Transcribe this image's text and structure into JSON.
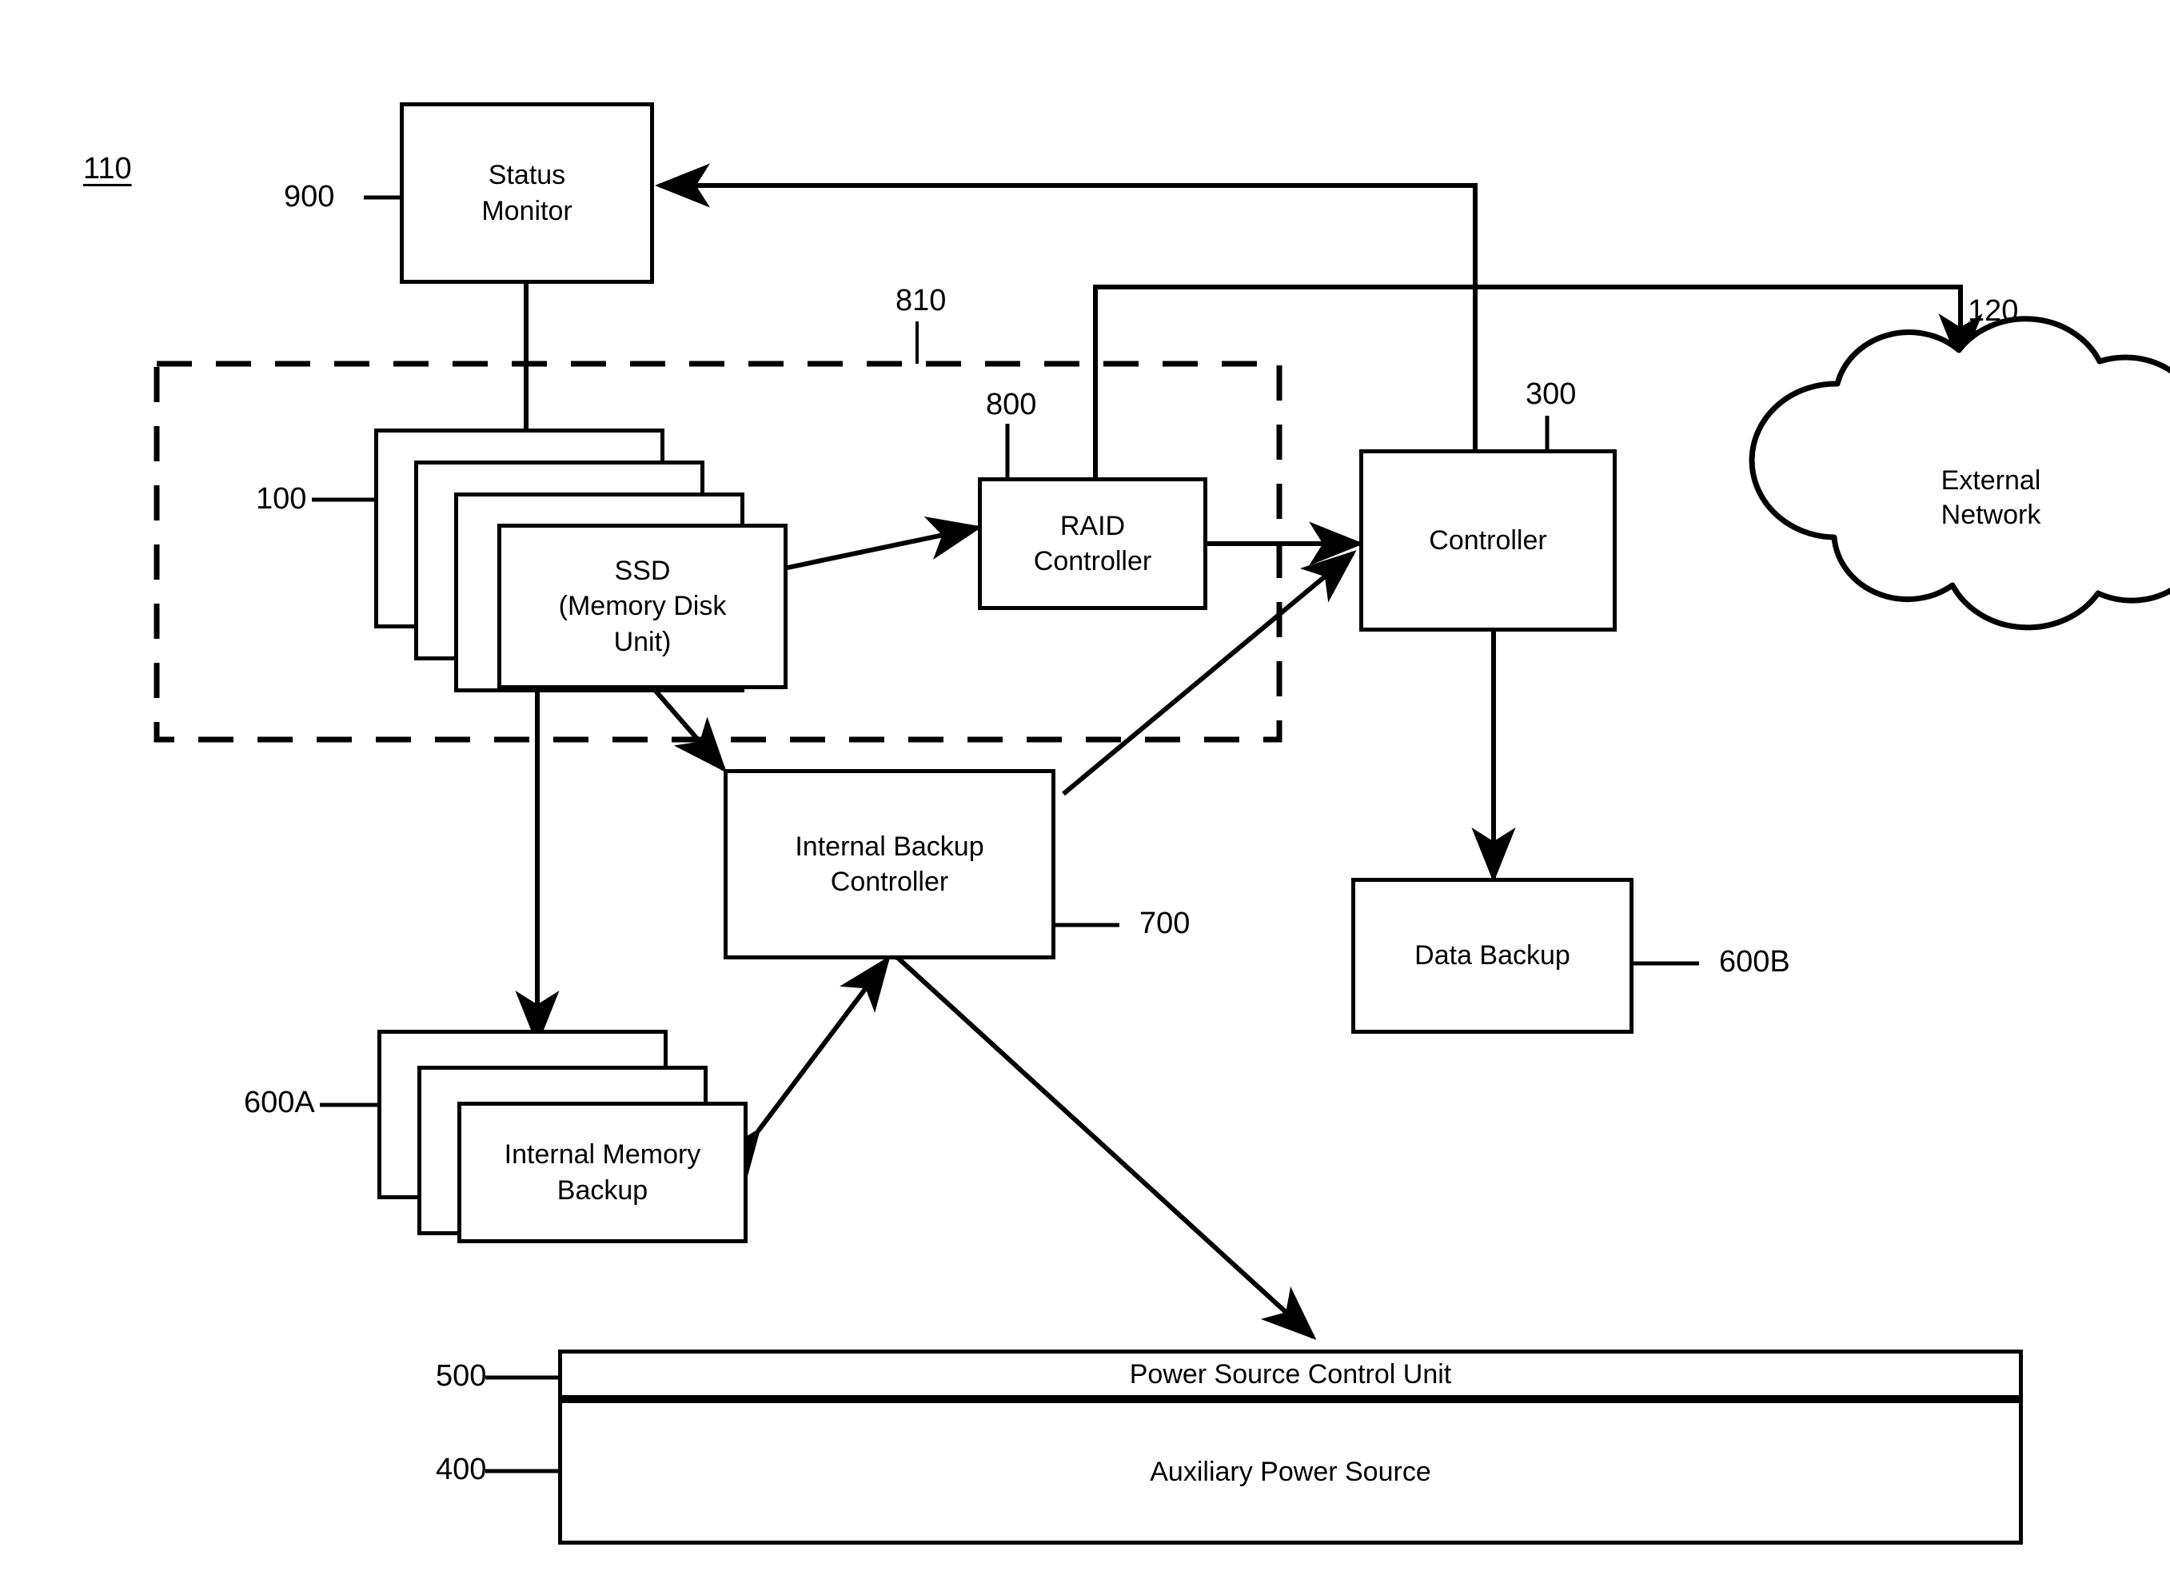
{
  "figure": {
    "system_ref": "110",
    "dashed_group_ref": "810"
  },
  "blocks": {
    "status_monitor": {
      "label": "Status\nMonitor",
      "ref": "900"
    },
    "ssd": {
      "label": "SSD\n(Memory Disk\nUnit)",
      "ref": "100"
    },
    "raid_controller": {
      "label": "RAID\nController",
      "ref": "800"
    },
    "controller": {
      "label": "Controller",
      "ref": "300"
    },
    "external_network": {
      "label": "External\nNetwork",
      "ref": "120"
    },
    "internal_backup_controller": {
      "label": "Internal Backup\nController",
      "ref": "700"
    },
    "data_backup": {
      "label": "Data Backup",
      "ref": "600B"
    },
    "internal_memory_backup": {
      "label": "Internal Memory\nBackup",
      "ref": "600A"
    },
    "power_source_control_unit": {
      "label": "Power Source Control Unit",
      "ref": "500"
    },
    "auxiliary_power_source": {
      "label": "Auxiliary Power Source",
      "ref": "400"
    }
  },
  "colors": {
    "ink": "#000000",
    "paper": "#ffffff"
  }
}
